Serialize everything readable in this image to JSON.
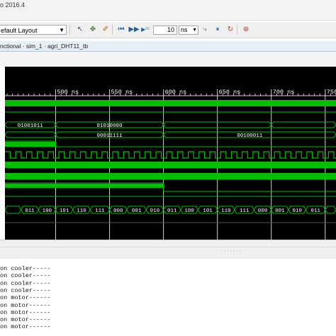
{
  "window": {
    "title": "o 2016.4"
  },
  "toolbar": {
    "layout": "efault Layout",
    "runtime_value": "10",
    "runtime_unit": "ns"
  },
  "tab": {
    "breadcrumb": "nctional · sim_1 · agri_DHT11_tb"
  },
  "waveform": {
    "time_unit": "ns",
    "ticks": [
      "500 ns",
      "550 ns",
      "600 ns",
      "650 ns",
      "700 ns",
      "750"
    ],
    "tick_times_ns": [
      500,
      550,
      600,
      650,
      700,
      750
    ],
    "view_start_ns": 453,
    "view_end_ns": 760,
    "signal_a": {
      "segments": [
        {
          "start": 453,
          "end": 500,
          "text": "01001011"
        },
        {
          "start": 500,
          "end": 600,
          "text": "01010000"
        },
        {
          "start": 600,
          "end": 700,
          "text": ""
        },
        {
          "start": 700,
          "end": 760,
          "text": ""
        }
      ]
    },
    "signal_b": {
      "segments": [
        {
          "start": 453,
          "end": 500,
          "text": ""
        },
        {
          "start": 500,
          "end": 600,
          "text": "00011111"
        },
        {
          "start": 600,
          "end": 760,
          "text": "00100011"
        }
      ]
    },
    "counter": {
      "segments": [
        {
          "start": 453,
          "end": 468,
          "text": ""
        },
        {
          "start": 468,
          "end": 484,
          "text": "011"
        },
        {
          "start": 484,
          "end": 500,
          "text": "100"
        },
        {
          "start": 500,
          "end": 516,
          "text": "101"
        },
        {
          "start": 516,
          "end": 532,
          "text": "110"
        },
        {
          "start": 532,
          "end": 550,
          "text": "111"
        },
        {
          "start": 550,
          "end": 566,
          "text": "000"
        },
        {
          "start": 566,
          "end": 584,
          "text": "001"
        },
        {
          "start": 584,
          "end": 600,
          "text": "010"
        },
        {
          "start": 600,
          "end": 616,
          "text": "011"
        },
        {
          "start": 616,
          "end": 632,
          "text": "100"
        },
        {
          "start": 632,
          "end": 650,
          "text": "101"
        },
        {
          "start": 650,
          "end": 666,
          "text": "110"
        },
        {
          "start": 666,
          "end": 684,
          "text": "111"
        },
        {
          "start": 684,
          "end": 700,
          "text": "000"
        },
        {
          "start": 700,
          "end": 716,
          "text": "001"
        },
        {
          "start": 716,
          "end": 732,
          "text": "010"
        },
        {
          "start": 732,
          "end": 750,
          "text": "011"
        },
        {
          "start": 750,
          "end": 760,
          "text": ""
        }
      ]
    }
  },
  "console": {
    "lines": [
      "on cooler-----",
      "on cooler-----",
      "on cooler-----",
      "on cooler-----",
      "on motor------",
      "on motor------",
      "on motor------",
      "on motor------",
      "on motor------"
    ]
  }
}
